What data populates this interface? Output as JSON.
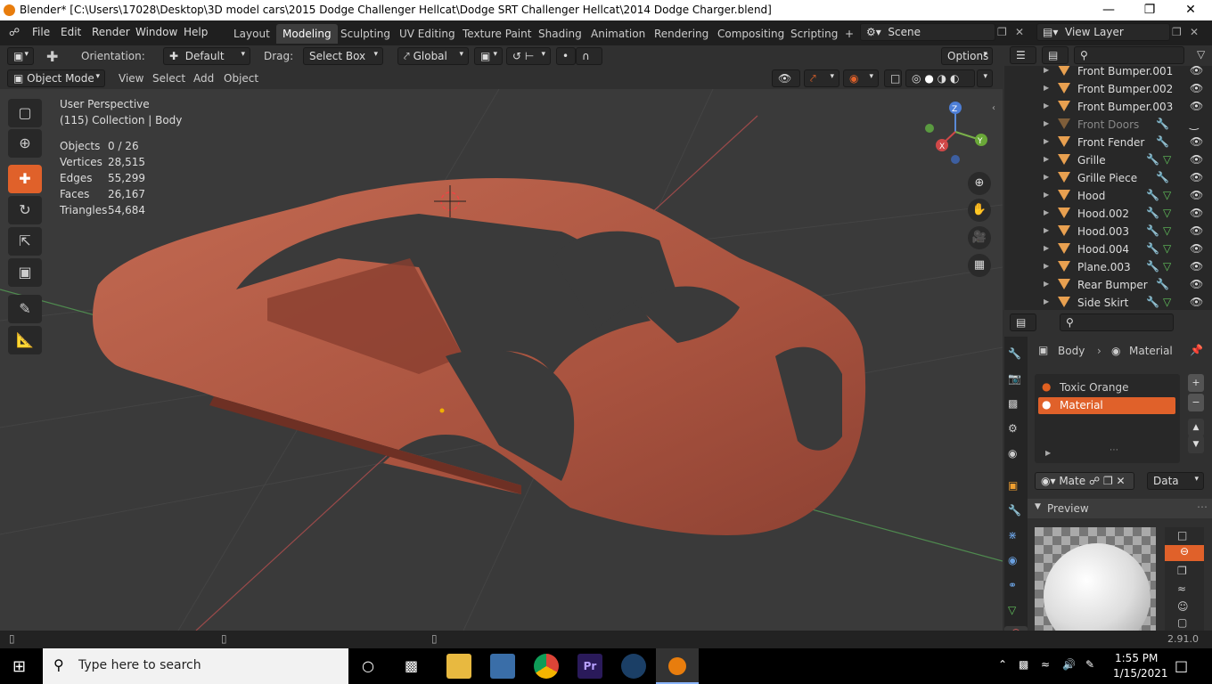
{
  "title": "Blender* [C:\\Users\\17028\\Desktop\\3D model cars\\2015 Dodge Challenger Hellcat\\Dodge SRT Challenger Hellcat\\2014 Dodge Charger.blend]",
  "menu": [
    "File",
    "Edit",
    "Render",
    "Window",
    "Help"
  ],
  "workspaces": [
    "Layout",
    "Modeling",
    "Sculpting",
    "UV Editing",
    "Texture Paint",
    "Shading",
    "Animation",
    "Rendering",
    "Compositing",
    "Scripting"
  ],
  "active_workspace": "Modeling",
  "scene": "Scene",
  "view_layer": "View Layer",
  "toolbar": {
    "orientation_label": "Orientation:",
    "orientation_value": "Default",
    "drag_label": "Drag:",
    "drag_value": "Select Box",
    "transform_value": "Global",
    "options": "Options"
  },
  "header2": {
    "mode": "Object Mode",
    "view": "View",
    "select": "Select",
    "add": "Add",
    "object": "Object"
  },
  "overlay": {
    "perspective": "User Perspective",
    "collection": "(115) Collection | Body",
    "stats": [
      {
        "label": "Objects",
        "value": "0 / 26"
      },
      {
        "label": "Vertices",
        "value": "28,515"
      },
      {
        "label": "Edges",
        "value": "55,299"
      },
      {
        "label": "Faces",
        "value": "26,167"
      },
      {
        "label": "Triangles",
        "value": "54,684"
      }
    ]
  },
  "outliner": [
    {
      "name": "Front Bumper.001",
      "mod": false,
      "mesh": false,
      "dim": false
    },
    {
      "name": "Front Bumper.002",
      "mod": false,
      "mesh": false,
      "dim": false
    },
    {
      "name": "Front Bumper.003",
      "mod": false,
      "mesh": false,
      "dim": false
    },
    {
      "name": "Front Doors",
      "mod": true,
      "mesh": false,
      "dim": true
    },
    {
      "name": "Front Fender",
      "mod": true,
      "mesh": false,
      "dim": false
    },
    {
      "name": "Grille",
      "mod": true,
      "mesh": true,
      "dim": false
    },
    {
      "name": "Grille Piece",
      "mod": true,
      "mesh": false,
      "dim": false
    },
    {
      "name": "Hood",
      "mod": true,
      "mesh": true,
      "dim": false
    },
    {
      "name": "Hood.002",
      "mod": true,
      "mesh": true,
      "dim": false
    },
    {
      "name": "Hood.003",
      "mod": true,
      "mesh": true,
      "dim": false
    },
    {
      "name": "Hood.004",
      "mod": true,
      "mesh": true,
      "dim": false
    },
    {
      "name": "Plane.003",
      "mod": true,
      "mesh": true,
      "dim": false
    },
    {
      "name": "Rear Bumper",
      "mod": true,
      "mesh": false,
      "dim": false
    },
    {
      "name": "Side Skirt",
      "mod": true,
      "mesh": true,
      "dim": false
    }
  ],
  "properties": {
    "object": "Body",
    "tab": "Material",
    "materials": [
      "Toxic Orange",
      "Material"
    ],
    "active_material": "Material",
    "slot_name": "Mate",
    "link": "Data",
    "preview": "Preview"
  },
  "version": "2.91.0",
  "taskbar": {
    "search_placeholder": "Type here to search",
    "time": "1:55 PM",
    "date": "1/15/2021"
  },
  "colors": {
    "accent": "#e0612a",
    "car": "#b55a45",
    "bg": "#3a3a3a"
  }
}
